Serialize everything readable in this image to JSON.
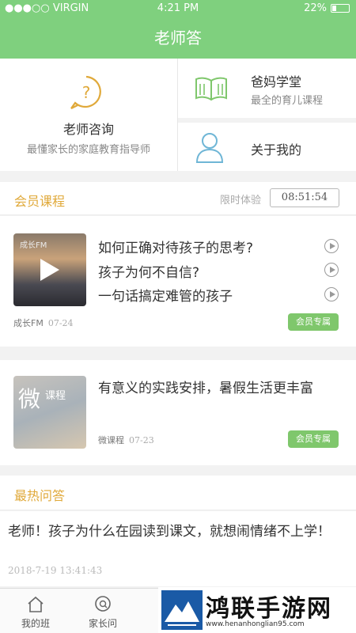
{
  "status": {
    "carrier": "●●●○○ VIRGIN",
    "time": "4:21 PM",
    "battery": "22%"
  },
  "navbar": {
    "title": "老师答"
  },
  "top": {
    "consult": {
      "title": "老师咨询",
      "subtitle": "最懂家长的家庭教育指导师"
    },
    "parent_school": {
      "title": "爸妈学堂",
      "subtitle": "最全的育儿课程"
    },
    "about": {
      "title": "关于我的"
    }
  },
  "member": {
    "title": "会员课程",
    "limit_label": "限时体验",
    "timer": "08:51:54"
  },
  "card1": {
    "thumb_tag": "成长FM",
    "lessons": [
      "如何正确对待孩子的思考?",
      "孩子为何不自信?",
      "一句话搞定难管的孩子"
    ],
    "source": "成长FM",
    "date": "07-24",
    "badge": "会员专属"
  },
  "card2": {
    "thumb_wei": "微",
    "thumb_kc": "课程",
    "title": "有意义的实践安排，暑假生活更丰富",
    "source": "微课程",
    "date": "07-23",
    "badge": "会员专属"
  },
  "hot": {
    "title": "最热问答",
    "question": "老师！孩子为什么在园读到课文，就想闹情绪不上学！",
    "time": "2018-7-19 13:41:43"
  },
  "tabs": [
    {
      "label": "我的班"
    },
    {
      "label": "家长问"
    }
  ],
  "watermark": {
    "text": "鸿联手游网",
    "url": "www.henanhonglian95.com"
  },
  "colors": {
    "primary": "#7fd07e",
    "accent": "#e0a93a",
    "badge": "#7fc76c"
  }
}
